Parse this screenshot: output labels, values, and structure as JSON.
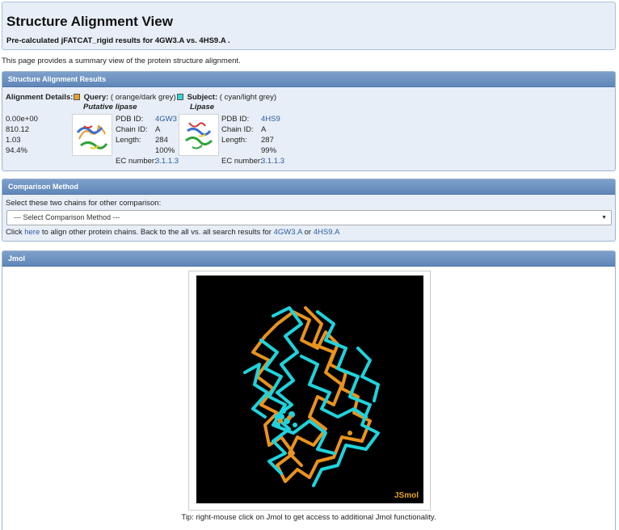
{
  "header": {
    "title": "Structure Alignment View",
    "subtitle": "Pre-calculated jFATCAT_rigid results for 4GW3.A vs. 4HS9.A ."
  },
  "intro": "This page provides a summary view of the protein structure alignment.",
  "results": {
    "heading": "Structure Alignment Results",
    "details_label": "Alignment Details:",
    "details_values": [
      "0.00e+00",
      "810.12",
      "1.03",
      "94.4%"
    ],
    "query": {
      "label": "Query:",
      "color_note": "( orange/dark grey)",
      "color": "#e8a323",
      "name": "Putative lipase",
      "pdb_label": "PDB ID:",
      "pdb_id": "4GW3",
      "chain_label": "Chain ID:",
      "chain_id": "A",
      "length_label": "Length:",
      "length": "284",
      "percent": "100%",
      "ec_label": "EC number:",
      "ec": "3.1.1.3"
    },
    "subject": {
      "label": "Subject:",
      "color_note": "( cyan/light grey)",
      "color": "#33d6d8",
      "name": "Lipase",
      "pdb_label": "PDB ID:",
      "pdb_id": "4HS9",
      "chain_label": "Chain ID:",
      "chain_id": "A",
      "length_label": "Length:",
      "length": "287",
      "percent": "99%",
      "ec_label": "EC number:",
      "ec": "3.1.1.3"
    }
  },
  "comparison": {
    "heading": "Comparison Method",
    "instruction": "Select these two chains for other comparison:",
    "select_value": "--- Select Comparison Method ---",
    "footer_text_1": "Click ",
    "footer_link_here": "here",
    "footer_text_2": " to align other protein chains. Back to the all vs. all search results for ",
    "footer_link_1": "4GW3.A",
    "footer_text_3": " or ",
    "footer_link_2": "4HS9.A"
  },
  "jmol": {
    "heading": "Jmol",
    "badge": "JSmol",
    "tip": "Tip: right-mouse click on Jmol to get access to additional Jmol functionality."
  },
  "colors": {
    "panel_header": "#6a90c0",
    "panel_bg": "#e7eef7",
    "link": "#2a5d9e"
  }
}
